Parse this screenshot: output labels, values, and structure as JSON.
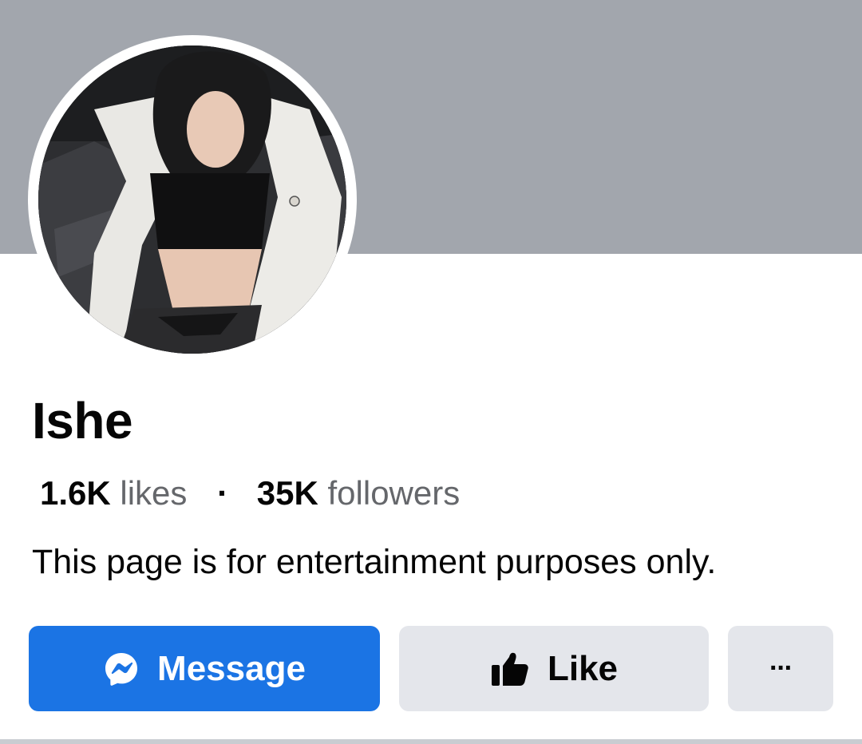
{
  "profile": {
    "name": "Ishe",
    "likes_count": "1.6K",
    "likes_label": "likes",
    "separator": "·",
    "followers_count": "35K",
    "followers_label": "followers",
    "bio": "This page is for entertainment purposes only."
  },
  "actions": {
    "message_label": "Message",
    "like_label": "Like",
    "more_label": "···"
  },
  "colors": {
    "cover": "#a2a6ad",
    "primary_button": "#1b74e4",
    "secondary_button": "#e4e6eb"
  },
  "icons": {
    "message": "messenger-icon",
    "like": "thumbs-up-icon",
    "more": "more-options-icon"
  }
}
